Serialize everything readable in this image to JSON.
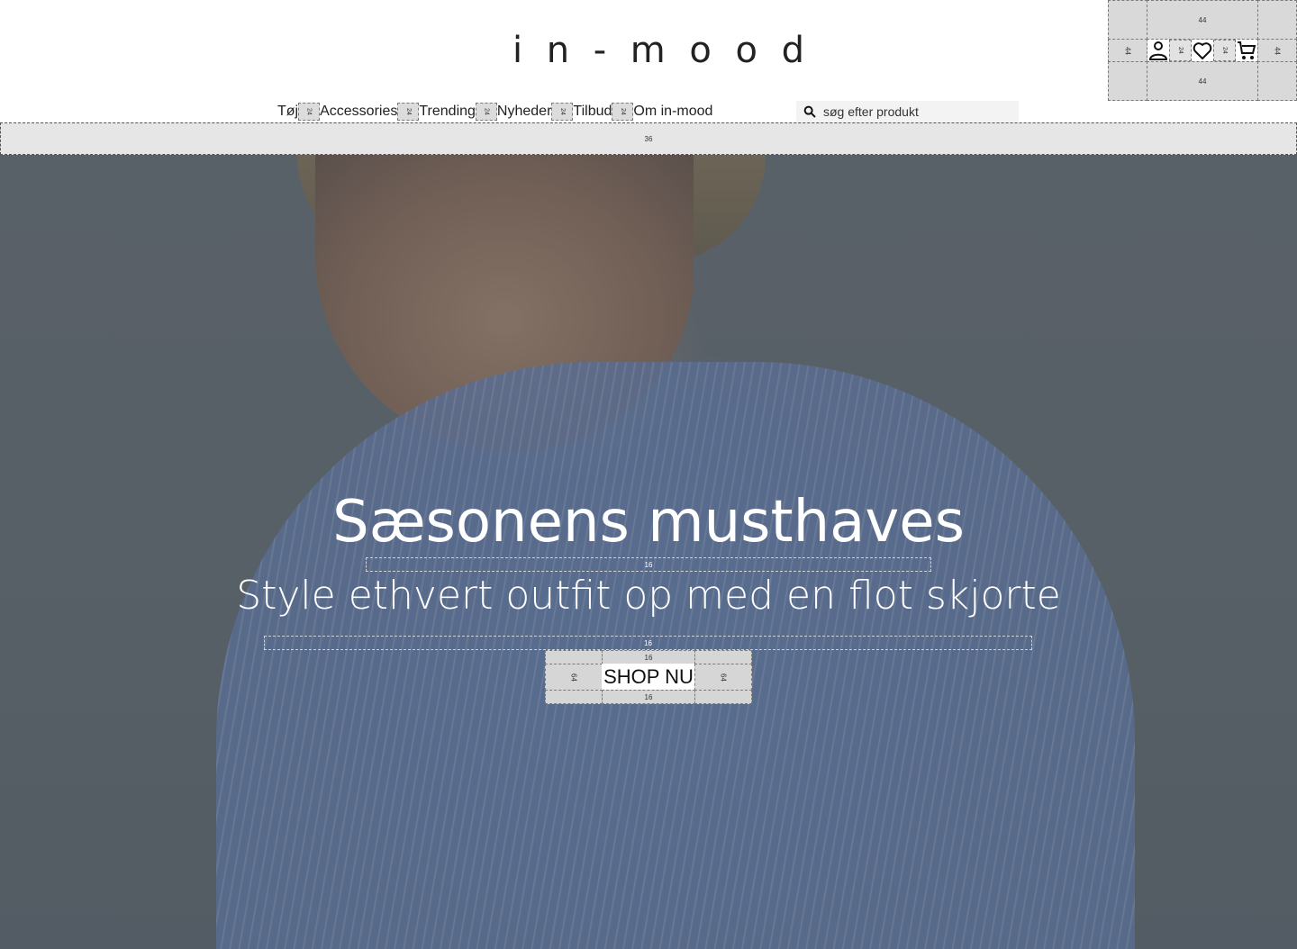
{
  "brand": {
    "logo_text": "in-mood"
  },
  "header_icons": {
    "account": "account-icon",
    "wishlist": "heart-icon",
    "cart": "cart-icon",
    "spacing_labels": {
      "top": "44",
      "bottom": "44",
      "left": "44",
      "right": "44",
      "gap1": "24",
      "gap2": "24"
    }
  },
  "nav": {
    "items": [
      {
        "label": "Tøj"
      },
      {
        "label": "Accessories"
      },
      {
        "label": "Trending"
      },
      {
        "label": "Nyheder"
      },
      {
        "label": "Tilbud"
      },
      {
        "label": "Om in-mood"
      }
    ],
    "gap_label": "24"
  },
  "search": {
    "placeholder": "søg efter produkt",
    "icon": "search-icon"
  },
  "topbar": {
    "label": "36"
  },
  "hero": {
    "title": "Sæsonens musthaves",
    "subtitle": "Style ethvert outfit op med en flot skjorte",
    "spacer_label": "16",
    "cta_label": "SHOP NU",
    "cta_pad_side": "64",
    "cta_pad_vertical": "16"
  }
}
